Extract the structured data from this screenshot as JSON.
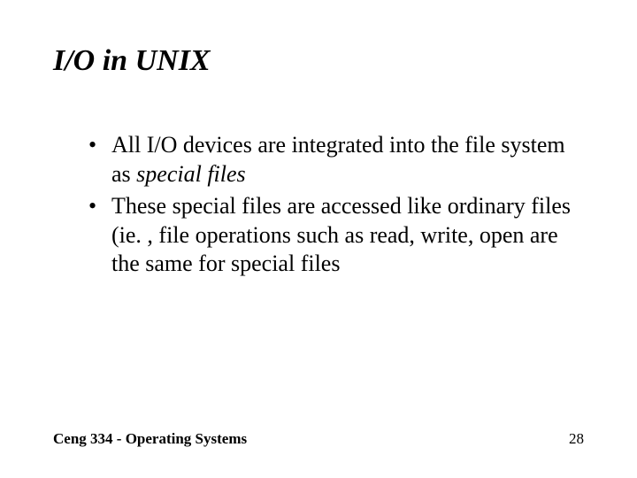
{
  "slide": {
    "title": "I/O in UNIX",
    "bullets": [
      {
        "pre": "All I/O devices are integrated into the file system as ",
        "em": "special files",
        "post": ""
      },
      {
        "pre": "These special files are accessed like ordinary files (ie. , file operations such as read, write, open are the same for special files",
        "em": "",
        "post": ""
      }
    ],
    "footer": {
      "course": "Ceng 334 - Operating Systems",
      "page": "28"
    }
  }
}
